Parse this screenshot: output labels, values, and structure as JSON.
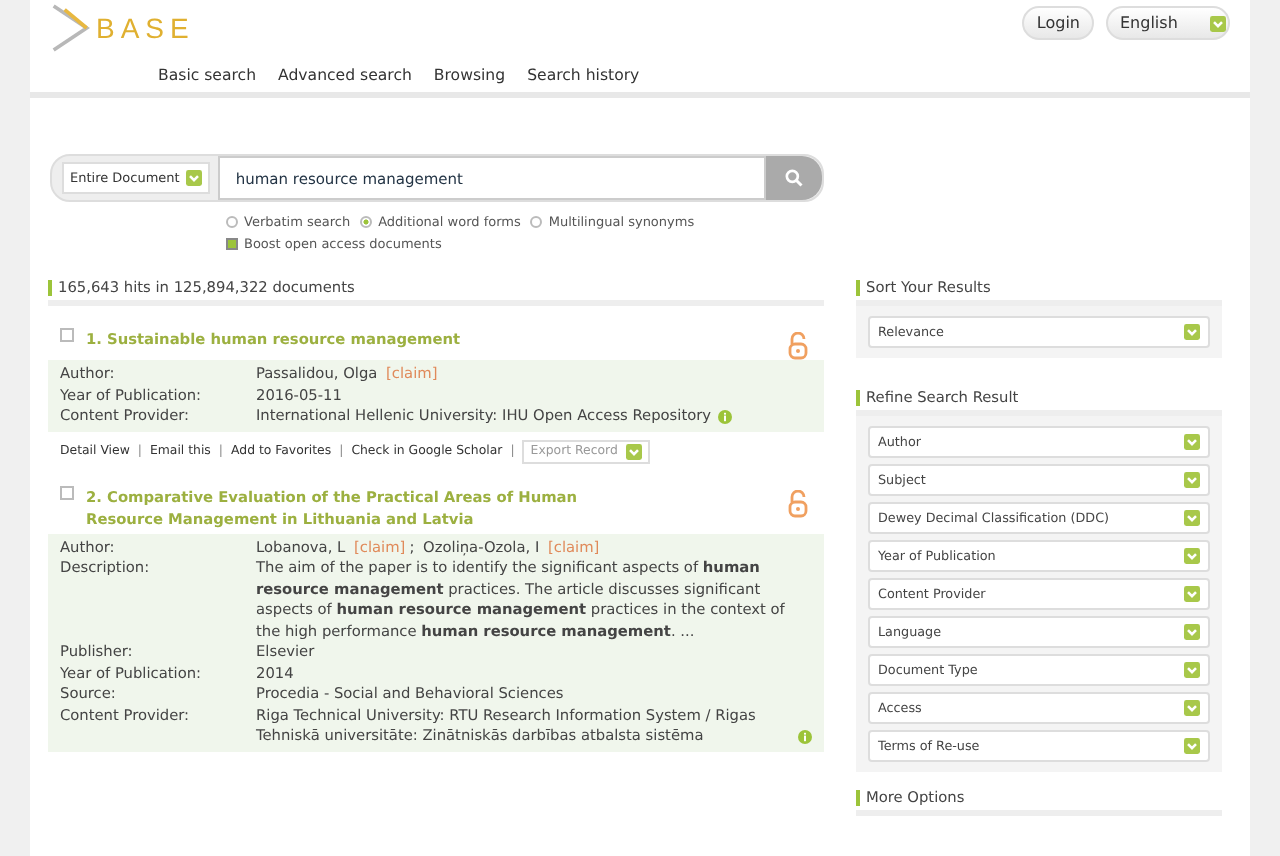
{
  "header": {
    "logo": "BASE",
    "login": "Login",
    "language": "English",
    "nav": [
      "Basic search",
      "Advanced search",
      "Browsing",
      "Search history"
    ]
  },
  "search": {
    "scope": "Entire Document",
    "value": "human resource management",
    "options": [
      {
        "label": "Verbatim search",
        "selected": false
      },
      {
        "label": "Additional word forms",
        "selected": true
      },
      {
        "label": "Multilingual synonyms",
        "selected": false
      }
    ],
    "boost": {
      "label": "Boost open access documents",
      "checked": true
    }
  },
  "hits": "165,643 hits in 125,894,322 documents",
  "results": [
    {
      "title": "1. Sustainable human resource management",
      "checked": false,
      "open_access": true,
      "fields": [
        {
          "kind": "authors",
          "label": "Author:",
          "authors": [
            {
              "name": "Passalidou, Olga",
              "claim": "[claim]"
            }
          ]
        },
        {
          "kind": "text",
          "label": "Year of Publication:",
          "value": "2016-05-11"
        },
        {
          "kind": "provider",
          "label": "Content Provider:",
          "value": "International Hellenic University: IHU Open Access Repository"
        }
      ],
      "actions": [
        "Detail View",
        "Email this",
        "Add to Favorites",
        "Check in Google Scholar"
      ],
      "action_separator": "|",
      "export": "Export Record"
    },
    {
      "title": "2. Comparative Evaluation of the Practical Areas of Human Resource Management in Lithuania and Latvia",
      "checked": false,
      "open_access": true,
      "fields": [
        {
          "kind": "authors",
          "label": "Author:",
          "separator": ";",
          "authors": [
            {
              "name": "Lobanova, L",
              "claim": "[claim]"
            },
            {
              "name": "Ozoliņa-Ozola, I",
              "claim": "[claim]"
            }
          ]
        },
        {
          "kind": "rich",
          "label": "Description:",
          "value": "The aim of the paper is to identify the significant aspects of **human resource management** practices. The article discusses significant aspects of **human resource management** practices in the context of the high performance **human resource management**. ..."
        },
        {
          "kind": "text",
          "label": "Publisher:",
          "value": "Elsevier"
        },
        {
          "kind": "text",
          "label": "Year of Publication:",
          "value": "2014"
        },
        {
          "kind": "text",
          "label": "Source:",
          "value": "Procedia - Social and Behavioral Sciences"
        },
        {
          "kind": "provider",
          "label": "Content Provider:",
          "value": "Riga Technical University: RTU Research Information System / Rigas Tehniskā universitāte: Zinātniskās darbības atbalsta sistēma"
        }
      ]
    }
  ],
  "sidebar": {
    "sort_title": "Sort Your Results",
    "sort_value": "Relevance",
    "refine_title": "Refine Search Result",
    "refine": [
      "Author",
      "Subject",
      "Dewey Decimal Classification (DDC)",
      "Year of Publication",
      "Content Provider",
      "Language",
      "Document Type",
      "Access",
      "Terms of Re-use"
    ],
    "more_title": "More Options"
  }
}
